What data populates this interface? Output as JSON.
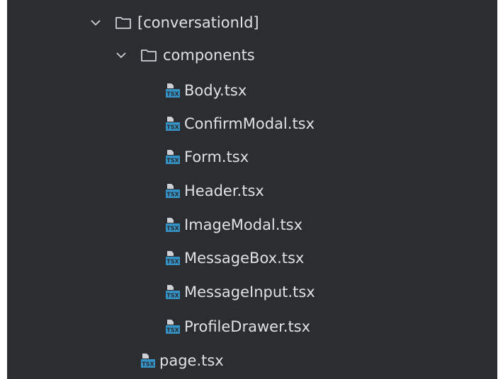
{
  "tree": {
    "folders": [
      {
        "label": "[conversationId]",
        "expanded": true,
        "icon": "folder-icon"
      },
      {
        "label": "components",
        "expanded": true,
        "icon": "folder-icon"
      }
    ],
    "component_files": [
      {
        "label": "Body.tsx",
        "icon": "tsx-file-icon"
      },
      {
        "label": "ConfirmModal.tsx",
        "icon": "tsx-file-icon"
      },
      {
        "label": "Form.tsx",
        "icon": "tsx-file-icon"
      },
      {
        "label": "Header.tsx",
        "icon": "tsx-file-icon"
      },
      {
        "label": "ImageModal.tsx",
        "icon": "tsx-file-icon"
      },
      {
        "label": "MessageBox.tsx",
        "icon": "tsx-file-icon"
      },
      {
        "label": "MessageInput.tsx",
        "icon": "tsx-file-icon"
      },
      {
        "label": "ProfileDrawer.tsx",
        "icon": "tsx-file-icon"
      }
    ],
    "root_files": [
      {
        "label": "page.tsx",
        "icon": "tsx-file-icon"
      }
    ]
  },
  "colors": {
    "background": "#2b2d30",
    "text": "#dfe1e5",
    "icon_gray": "#ced0d6",
    "tsx_badge": "#3592c4"
  }
}
